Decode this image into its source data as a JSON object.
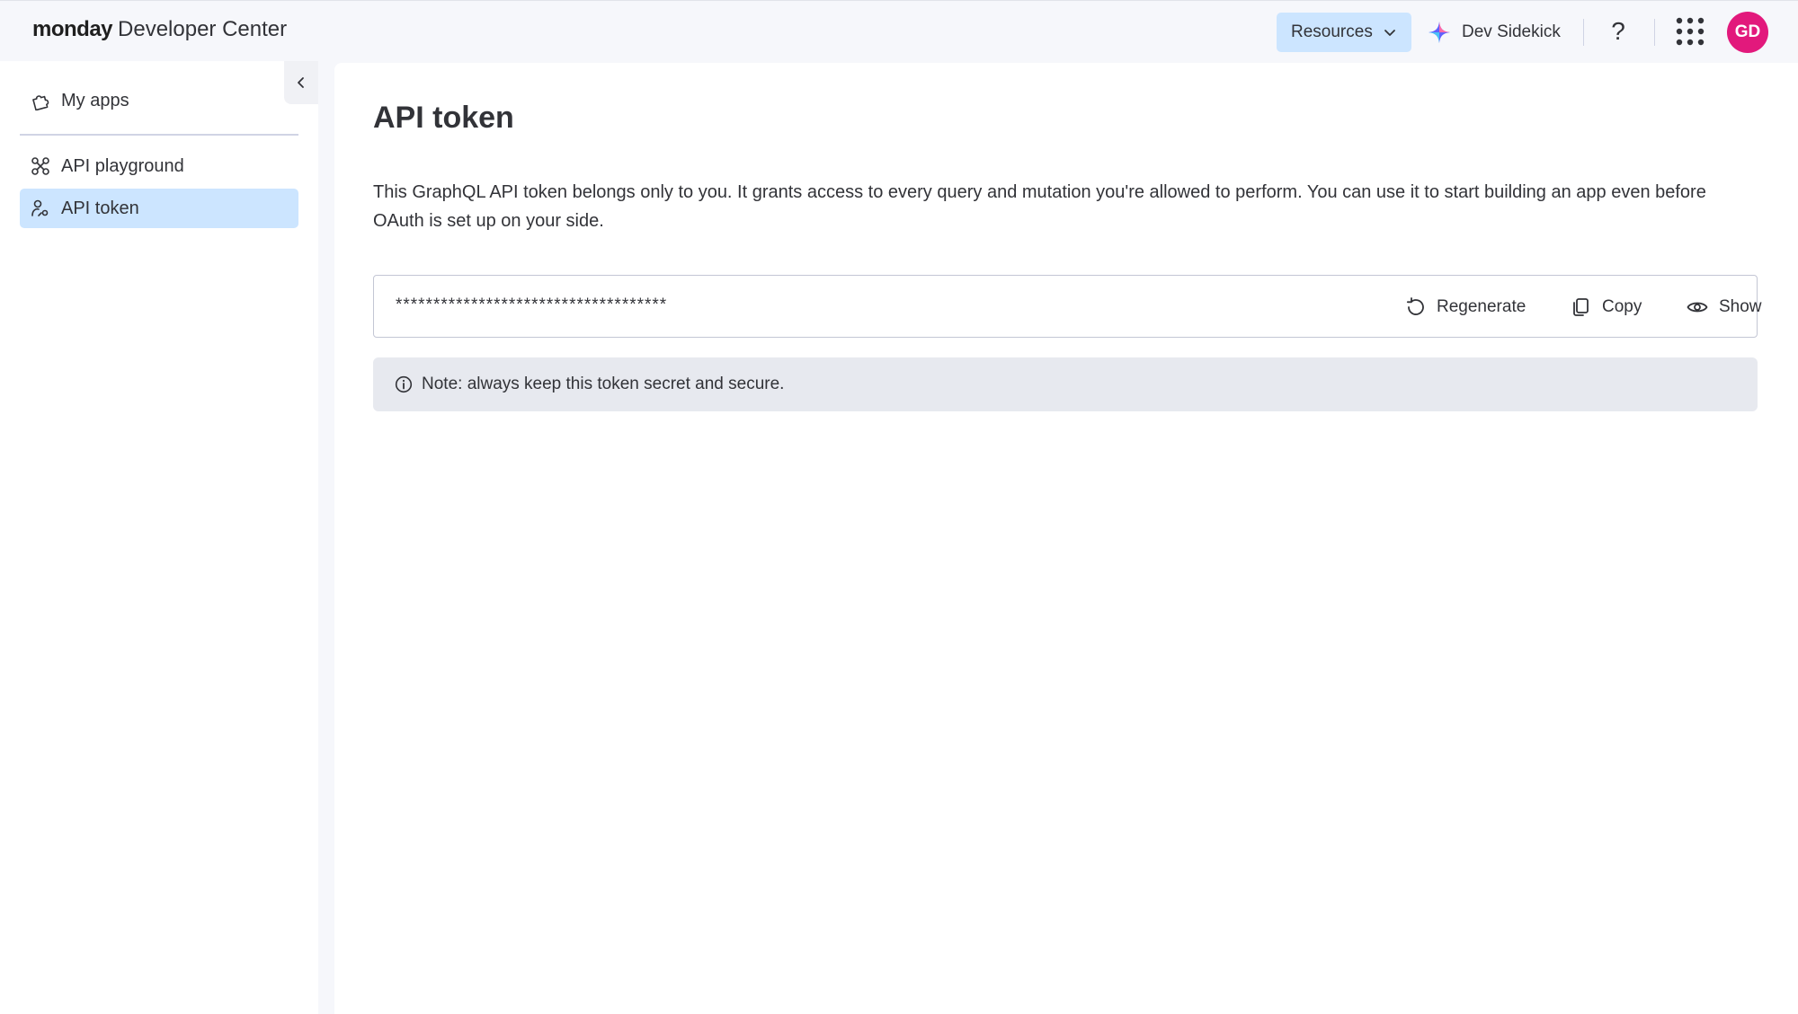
{
  "header": {
    "brand_bold": "monday",
    "brand_rest": "Developer Center",
    "resources_label": "Resources",
    "sidekick_label": "Dev Sidekick",
    "help_label": "?",
    "avatar_initials": "GD",
    "avatar_color": "#e2197c"
  },
  "sidebar": {
    "items": [
      {
        "label": "My apps",
        "icon": "puzzle-icon",
        "active": false
      },
      {
        "label": "API playground",
        "icon": "playground-icon",
        "active": false
      },
      {
        "label": "API token",
        "icon": "person-token-icon",
        "active": true
      }
    ]
  },
  "main": {
    "title": "API token",
    "description": "This GraphQL API token belongs only to you. It grants access to every query and mutation you're allowed to perform. You can use it to start building an app even before OAuth is set up on your side.",
    "token_masked": "************************************",
    "actions": {
      "regenerate": "Regenerate",
      "copy": "Copy",
      "show": "Show"
    },
    "note": "Note: always keep this token secret and secure."
  },
  "colors": {
    "accent_selected": "#cce5ff",
    "text": "#323338",
    "note_bg": "#e7e9ef"
  }
}
